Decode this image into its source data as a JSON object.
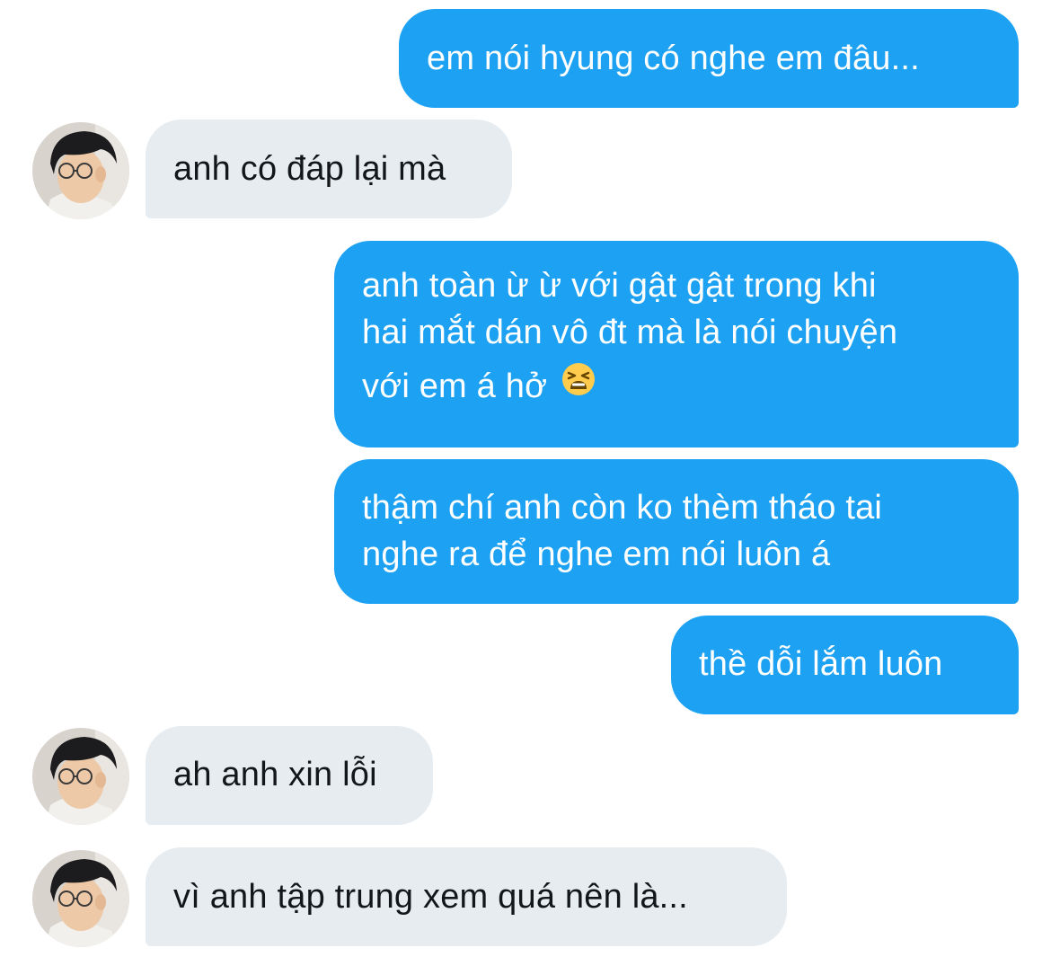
{
  "conversation": {
    "messages": [
      {
        "side": "sent",
        "lines": [
          "em nói hyung có nghe em đâu..."
        ]
      },
      {
        "side": "received",
        "lines": [
          "anh có đáp lại mà"
        ],
        "avatar_icon": "user-avatar-icon"
      },
      {
        "side": "sent",
        "lines": [
          "anh toàn ừ ừ với gật gật trong khi",
          "hai mắt dán vô đt mà là nói chuyện",
          "với em á hở"
        ],
        "emoji": "tired-face-emoji"
      },
      {
        "side": "sent",
        "lines": [
          "thậm chí anh còn ko thèm tháo tai",
          "nghe ra để nghe em nói luôn á"
        ]
      },
      {
        "side": "sent",
        "lines": [
          "thề dỗi lắm luôn"
        ]
      },
      {
        "side": "received",
        "lines": [
          "ah anh xin lỗi"
        ],
        "avatar_icon": "user-avatar-icon"
      },
      {
        "side": "received",
        "lines": [
          "vì anh tập trung xem quá nên là..."
        ],
        "avatar_icon": "user-avatar-icon"
      }
    ]
  },
  "colors": {
    "sent_bubble": "#1da1f2",
    "received_bubble": "#e6ecf0",
    "sent_text": "#ffffff",
    "received_text": "#14171a"
  }
}
